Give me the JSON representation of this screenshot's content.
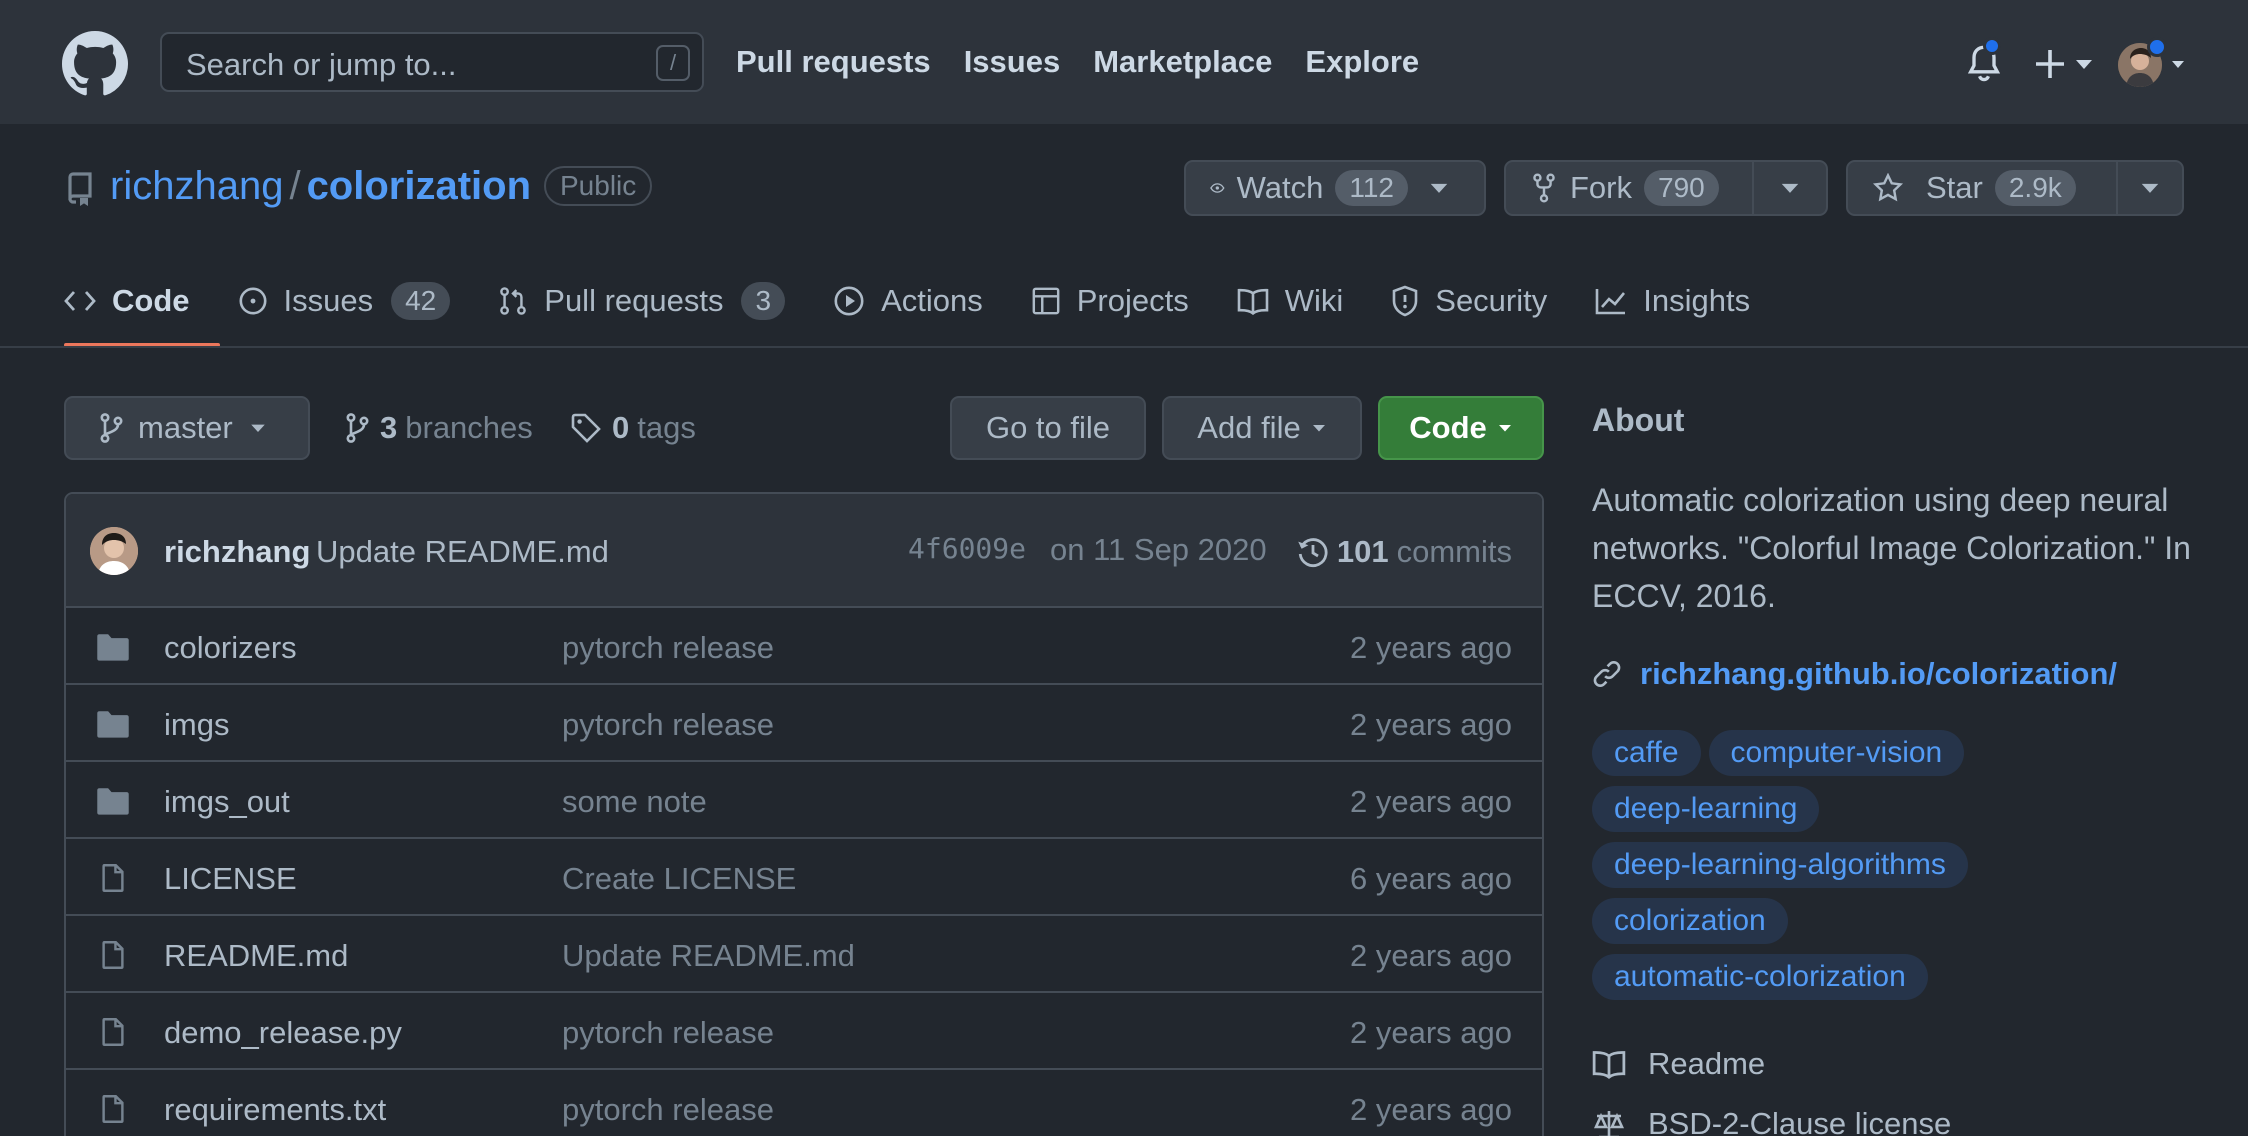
{
  "header": {
    "search_placeholder": "Search or jump to...",
    "search_key": "/",
    "nav": [
      "Pull requests",
      "Issues",
      "Marketplace",
      "Explore"
    ]
  },
  "repo": {
    "owner": "richzhang",
    "separator": "/",
    "name": "colorization",
    "visibility": "Public",
    "watch_label": "Watch",
    "watch_count": "112",
    "fork_label": "Fork",
    "fork_count": "790",
    "star_label": "Star",
    "star_count": "2.9k"
  },
  "tabs": [
    {
      "label": "Code",
      "count": null,
      "icon": "code-icon"
    },
    {
      "label": "Issues",
      "count": "42",
      "icon": "issue-icon"
    },
    {
      "label": "Pull requests",
      "count": "3",
      "icon": "pull-request-icon"
    },
    {
      "label": "Actions",
      "count": null,
      "icon": "play-icon"
    },
    {
      "label": "Projects",
      "count": null,
      "icon": "table-icon"
    },
    {
      "label": "Wiki",
      "count": null,
      "icon": "book-icon"
    },
    {
      "label": "Security",
      "count": null,
      "icon": "shield-icon"
    },
    {
      "label": "Insights",
      "count": null,
      "icon": "graph-icon"
    }
  ],
  "filenav": {
    "branch": "master",
    "branches_count": "3",
    "branches_label": "branches",
    "tags_count": "0",
    "tags_label": "tags",
    "goto_file": "Go to file",
    "add_file": "Add file",
    "code": "Code"
  },
  "commit": {
    "author": "richzhang",
    "message": "Update README.md",
    "sha": "4f6009e",
    "date": "on 11 Sep 2020",
    "count": "101",
    "count_label": "commits"
  },
  "files": [
    {
      "type": "dir",
      "name": "colorizers",
      "message": "pytorch release",
      "age": "2 years ago"
    },
    {
      "type": "dir",
      "name": "imgs",
      "message": "pytorch release",
      "age": "2 years ago"
    },
    {
      "type": "dir",
      "name": "imgs_out",
      "message": "some note",
      "age": "2 years ago"
    },
    {
      "type": "file",
      "name": "LICENSE",
      "message": "Create LICENSE",
      "age": "6 years ago"
    },
    {
      "type": "file",
      "name": "README.md",
      "message": "Update README.md",
      "age": "2 years ago"
    },
    {
      "type": "file",
      "name": "demo_release.py",
      "message": "pytorch release",
      "age": "2 years ago"
    },
    {
      "type": "file",
      "name": "requirements.txt",
      "message": "pytorch release",
      "age": "2 years ago"
    }
  ],
  "about": {
    "title": "About",
    "description": "Automatic colorization using deep neural networks. \"Colorful Image Colorization.\" In ECCV, 2016.",
    "link": "richzhang.github.io/colorization/",
    "topics": [
      "caffe",
      "computer-vision",
      "deep-learning",
      "deep-learning-algorithms",
      "colorization",
      "automatic-colorization"
    ],
    "readme": "Readme",
    "license": "BSD-2-Clause license"
  },
  "colors": {
    "accent_link": "#539bf5",
    "tab_underline": "#ec775c",
    "code_button": "#347d39",
    "notification_dot": "#1f6feb"
  }
}
